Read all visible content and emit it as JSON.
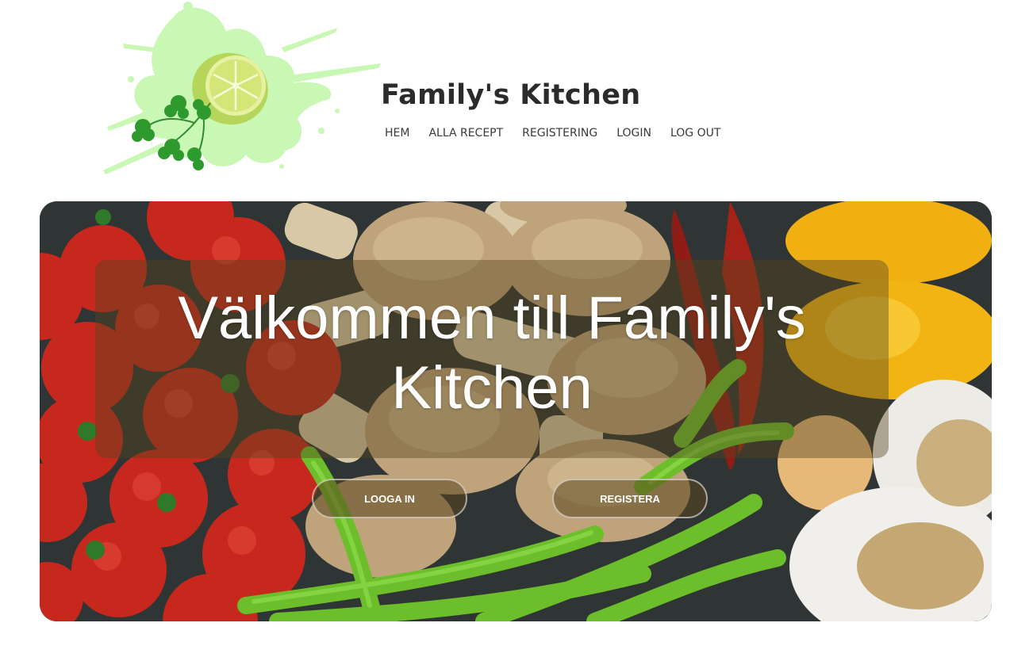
{
  "header": {
    "site_title": "Family's Kitchen",
    "logo_icon": "lime-splash-logo"
  },
  "nav": {
    "items": [
      {
        "label": "HEM"
      },
      {
        "label": "ALLA RECEPT"
      },
      {
        "label": "REGISTERING"
      },
      {
        "label": "LOGIN"
      },
      {
        "label": "LOG OUT"
      }
    ]
  },
  "hero": {
    "title": "Välkommen till Family's Kitchen",
    "login_button": "LOOGA IN",
    "register_button": "REGISTERA",
    "background_image": "vegetables-photo"
  },
  "colors": {
    "title_text": "#2b2b2b",
    "nav_text": "#3a3a3a",
    "splash_green": "#c9f7b4",
    "lime": "#b5d65a",
    "tomato": "#c92a1f",
    "pepper_yellow": "#f2b412",
    "chili_green": "#6cbf2a"
  }
}
